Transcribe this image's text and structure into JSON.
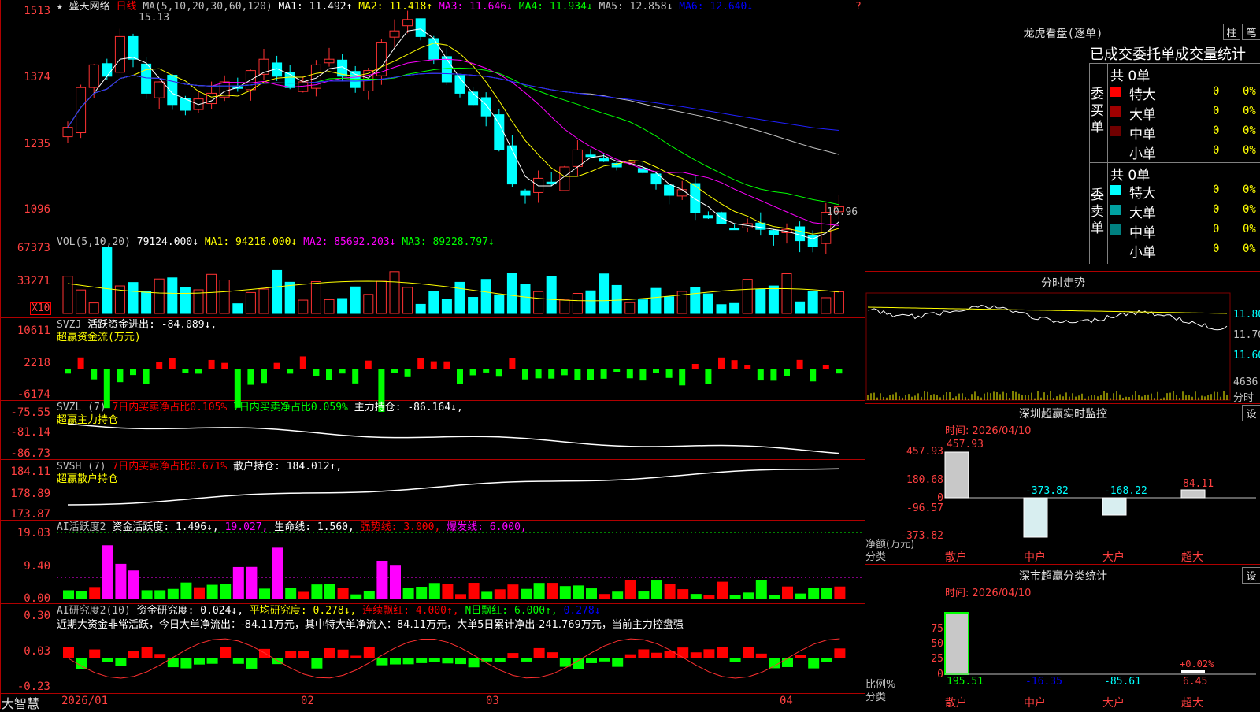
{
  "main_chart": {
    "title": "★ 盛天网络",
    "period": "日线",
    "ma_header": "MA(5,10,20,30,60,120)",
    "ma_items": [
      {
        "label": "MA1: 11.492↑",
        "color": "#ffffff"
      },
      {
        "label": "MA2: 11.418↑",
        "color": "#ffff00"
      },
      {
        "label": "MA3: 11.646↓",
        "color": "#ff00ff"
      },
      {
        "label": "MA4: 11.934↓",
        "color": "#00ff00"
      },
      {
        "label": "MA5: 12.858↓",
        "color": "#c0c0c0"
      },
      {
        "label": "MA6: 12.640↓",
        "color": "#0000ff"
      }
    ],
    "y_ticks": [
      "1513",
      "1374",
      "1235",
      "1096"
    ],
    "high_mark": "15.13",
    "low_mark": "10.96",
    "question_mark": "?"
  },
  "vol": {
    "header": "VOL(5,10,20)",
    "items": [
      {
        "label": "79124.000↓",
        "color": "#ffffff"
      },
      {
        "label": "MA1: 94216.000↓",
        "color": "#ffff00"
      },
      {
        "label": "MA2: 85692.203↓",
        "color": "#ff00ff"
      },
      {
        "label": "MA3: 89228.797↓",
        "color": "#00ff00"
      }
    ],
    "y_ticks": [
      "67373",
      "33271"
    ],
    "unit": "X10"
  },
  "svzj": {
    "header": "SVZJ",
    "item": "活跃资金进出: -84.089↓,",
    "subtitle": "超赢资金流(万元)",
    "y_ticks": [
      "10611",
      "2218",
      "-6174"
    ]
  },
  "svzl": {
    "header": "SVZL (7)",
    "item1": "7日内买卖净占比0.105%",
    "item2": "7日内买卖净占比0.059%",
    "item3": "主力持仓: -86.164↓,",
    "subtitle": "超赢主力持仓",
    "y_ticks": [
      "-75.55",
      "-81.14",
      "-86.73"
    ]
  },
  "svsh": {
    "header": "SVSH (7)",
    "item1": "7日内买卖净占比0.671%",
    "item2": "散户持仓: 184.012↑,",
    "subtitle": "超赢散户持仓",
    "y_ticks": [
      "184.11",
      "178.89",
      "173.87"
    ]
  },
  "ai_active": {
    "header": "AI活跃度2",
    "item1": "资金活跃度: 1.496↓,",
    "item2": "19.027,",
    "item3": "生命线: 1.560,",
    "item4": "强势线: 3.000,",
    "item5": "爆发线: 6.000,",
    "y_ticks": [
      "19.03",
      "9.40",
      "0.00"
    ]
  },
  "ai_research": {
    "header": "AI研究度2(10)",
    "item1": "资金研究度: 0.024↓,",
    "item2": "平均研究度: 0.278↓,",
    "item3": "连续飘红: 4.000↑,",
    "item4": "N日飘红: 6.000↑,",
    "item5": "0.278↓",
    "summary": "近期大资金非常活跃，今日大单净流出：-84.11万元，其中特大单净流入：84.11万元，大单5日累计净出-241.769万元，当前主力控盘强",
    "y_ticks": [
      "0.30",
      "0.03",
      "-0.23"
    ]
  },
  "bottom_axis": {
    "brand": "大智慧",
    "dates": [
      "2026/01",
      "02",
      "03",
      "04"
    ]
  },
  "dragon_tiger": {
    "title": "龙虎看盘(逐单)",
    "btn_zhu": "柱",
    "btn_bi": "笔",
    "section_title": "已成交委托单成交量统计",
    "buy_label": "委买单",
    "sell_label": "委卖单",
    "buy_total": "共 0单",
    "sell_total": "共 0单",
    "buy_rows": [
      {
        "name": "特大",
        "value": "0",
        "pct": "0%",
        "color": "#ff0000"
      },
      {
        "name": "大单",
        "value": "0",
        "pct": "0%",
        "color": "#a00000"
      },
      {
        "name": "中单",
        "value": "0",
        "pct": "0%",
        "color": "#700000"
      },
      {
        "name": "小单",
        "value": "0",
        "pct": "0%",
        "color": "#000000"
      }
    ],
    "sell_rows": [
      {
        "name": "特大",
        "value": "0",
        "pct": "0%",
        "color": "#00ffff"
      },
      {
        "name": "大单",
        "value": "0",
        "pct": "0%",
        "color": "#00a0a0"
      },
      {
        "name": "中单",
        "value": "0",
        "pct": "0%",
        "color": "#008080"
      },
      {
        "name": "小单",
        "value": "0",
        "pct": "0%",
        "color": "#000000"
      }
    ]
  },
  "intraday": {
    "title": "分时走势",
    "prices": [
      "11.80",
      "11.70",
      "11.60"
    ],
    "volume": "4636",
    "label": "分时"
  },
  "realtime_monitor": {
    "title": "深圳超赢实时监控",
    "btn": "设",
    "time": "时间: 2026/04/10",
    "y_ticks": [
      "457.93",
      "180.68",
      "0",
      "-96.57",
      "-373.82"
    ],
    "axis_label": "净额(万元)",
    "cat_label": "分类",
    "categories": [
      "散户",
      "中户",
      "大户",
      "超大"
    ],
    "values": [
      "457.93",
      "-373.82",
      "-168.22",
      "84.11"
    ]
  },
  "category_stats": {
    "title": "深市超赢分类统计",
    "btn": "设",
    "time": "时间: 2026/04/10",
    "y_ticks": [
      "75",
      "50",
      "25",
      "0"
    ],
    "axis_label": "比例%",
    "cat_label": "分类",
    "categories": [
      "散户",
      "中户",
      "大户",
      "超大"
    ],
    "values": [
      "195.51",
      "-16.35",
      "-85.61",
      "6.45"
    ],
    "note": "+0.02%"
  }
}
